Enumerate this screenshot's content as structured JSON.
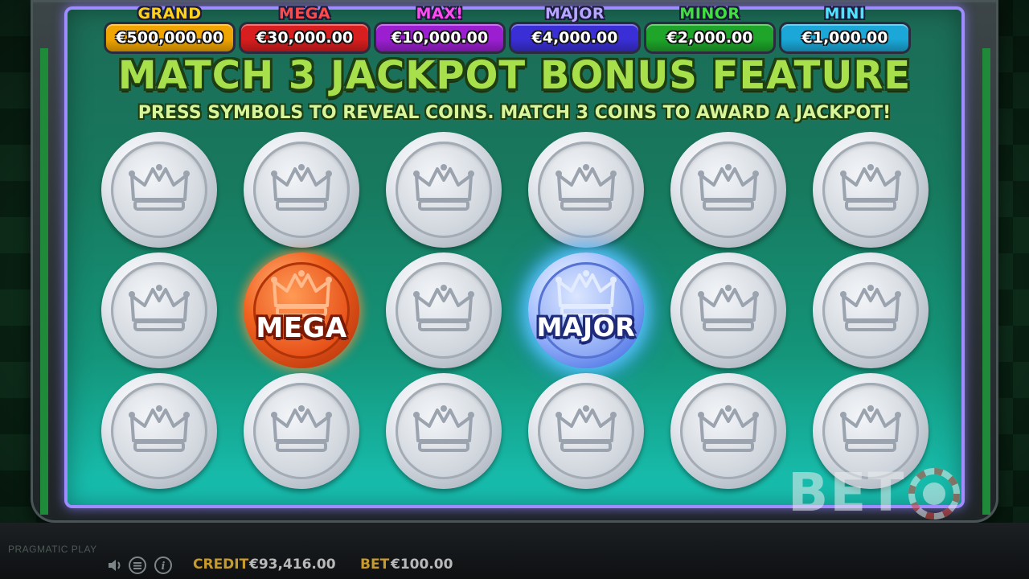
{
  "jackpots": [
    {
      "name": "GRAND",
      "value": "€500,000.00",
      "name_color": "#ffd21a",
      "box_color": "#f0a500"
    },
    {
      "name": "MEGA",
      "value": "€30,000.00",
      "name_color": "#ff4a4a",
      "box_color": "#d81e1e"
    },
    {
      "name": "MAX!",
      "value": "€10,000.00",
      "name_color": "#ff4cf0",
      "box_color": "#9b1fd1"
    },
    {
      "name": "MAJOR",
      "value": "€4,000.00",
      "name_color": "#b7a6ff",
      "box_color": "#3a2fd6"
    },
    {
      "name": "MINOR",
      "value": "€2,000.00",
      "name_color": "#40e040",
      "box_color": "#1ea52a"
    },
    {
      "name": "MINI",
      "value": "€1,000.00",
      "name_color": "#4fe3ff",
      "box_color": "#1ba8d8"
    }
  ],
  "bonus": {
    "title": "MATCH 3 JACKPOT BONUS FEATURE",
    "instructions": "PRESS SYMBOLS TO REVEAL COINS. MATCH 3 COINS TO AWARD A JACKPOT!"
  },
  "coins": {
    "rows": 3,
    "cols": 6,
    "revealed": [
      {
        "row": 2,
        "col": 2,
        "label": "MEGA",
        "kind": "mega"
      },
      {
        "row": 2,
        "col": 4,
        "label": "MAJOR",
        "kind": "major"
      }
    ],
    "hidden_icon": "crown-icon"
  },
  "footer": {
    "provider": "PRAGMATIC PLAY",
    "credit_label": "CREDIT",
    "credit_value": "€93,416.00",
    "bet_label": "BET",
    "bet_value": "€100.00",
    "controls": [
      "sound-icon",
      "menu-icon",
      "info-icon"
    ]
  },
  "watermark": {
    "text": "BET"
  },
  "colors": {
    "title_green": "#a8e04c",
    "credit_gold": "#c79a2c",
    "screen_glow": "#9f8cff"
  }
}
